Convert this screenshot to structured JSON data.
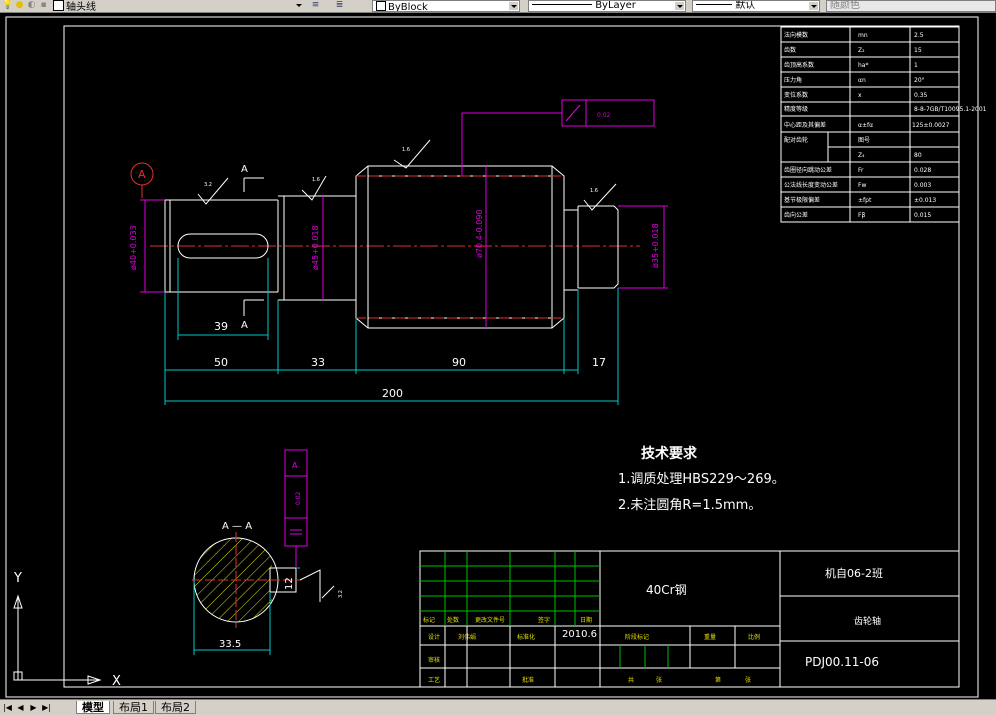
{
  "toolbar": {
    "layer_name": "轴头线",
    "color_value": "ByBlock",
    "linetype_value": "ByLayer",
    "lineweight_value": "默认",
    "plotstyle_value": "随颜色"
  },
  "drawing": {
    "balloon_label": "A",
    "section_label_a": "A",
    "section_title": "A — A",
    "dimensions": {
      "d_left": "ø40+0.033",
      "d_left2": "ø45+0.018",
      "d_mid": "ø70.4-0.090",
      "d_right": "ø35+0.018",
      "key_len": "39",
      "seg1": "50",
      "seg2": "33",
      "seg3": "90",
      "seg4": "17",
      "total": "200",
      "section_width": "33.5",
      "section_key": "12",
      "tolerance_top": "0.02",
      "tolerance_section": "0.02",
      "roughness_a": "3.2",
      "roughness_b": "1.6",
      "roughness_c": "1.6",
      "roughness_d": "1.6",
      "roughness_e": "3.2"
    },
    "tech_req": {
      "title": "技术要求",
      "line1": "1.调质处理HBS229～269。",
      "line2": "2.未注圆角R=1.5mm。"
    },
    "gear_table": [
      {
        "name": "法向模数",
        "sym": "mn",
        "val": "2.5"
      },
      {
        "name": "齿数",
        "sym": "Z₂",
        "val": "15"
      },
      {
        "name": "齿顶高系数",
        "sym": "ha*",
        "val": "1"
      },
      {
        "name": "压力角",
        "sym": "αn",
        "val": "20°"
      },
      {
        "name": "变位系数",
        "sym": "x",
        "val": "0.35"
      },
      {
        "name": "精度等级",
        "sym": "",
        "val": "8-8-7GB/T10095.1-2001"
      },
      {
        "name": "中心距及其偏差",
        "sym": "α±fα",
        "val": "125±0.0027"
      },
      {
        "name": "配对齿轮",
        "sym": "图号",
        "val": ""
      },
      {
        "name": "",
        "sym": "Z₄",
        "val": "80"
      },
      {
        "name": "齿圈径向跳动公差",
        "sym": "Fr",
        "val": "0.028"
      },
      {
        "name": "公法线长度变动公差",
        "sym": "Fw",
        "val": "0.003"
      },
      {
        "name": "基节极限偏差",
        "sym": "±fpt",
        "val": "±0.013"
      },
      {
        "name": "齿向公差",
        "sym": "Fβ",
        "val": "0.015"
      }
    ],
    "title_block": {
      "material": "40Cr钢",
      "school": "机自06-2班",
      "part_name": "齿轮轴",
      "drawing_no": "PDJ00.11-06",
      "date": "2010.6",
      "designer": "设计",
      "designer_name": "刘伟娟",
      "standard": "标准化",
      "mark": "标记",
      "count": "处数",
      "zone": "更改文件号",
      "sign": "签字",
      "date_label": "日期",
      "stage": "阶段标记",
      "weight": "重量",
      "scale": "比例",
      "review": "审核",
      "process": "工艺",
      "approve": "批准",
      "sheets": "共",
      "sheet": "张",
      "page": "第",
      "page2": "张"
    },
    "ucs": {
      "x": "X",
      "y": "Y"
    }
  },
  "statusbar": {
    "tab_model": "模型",
    "tab_layout1": "布局1",
    "tab_layout2": "布局2"
  }
}
